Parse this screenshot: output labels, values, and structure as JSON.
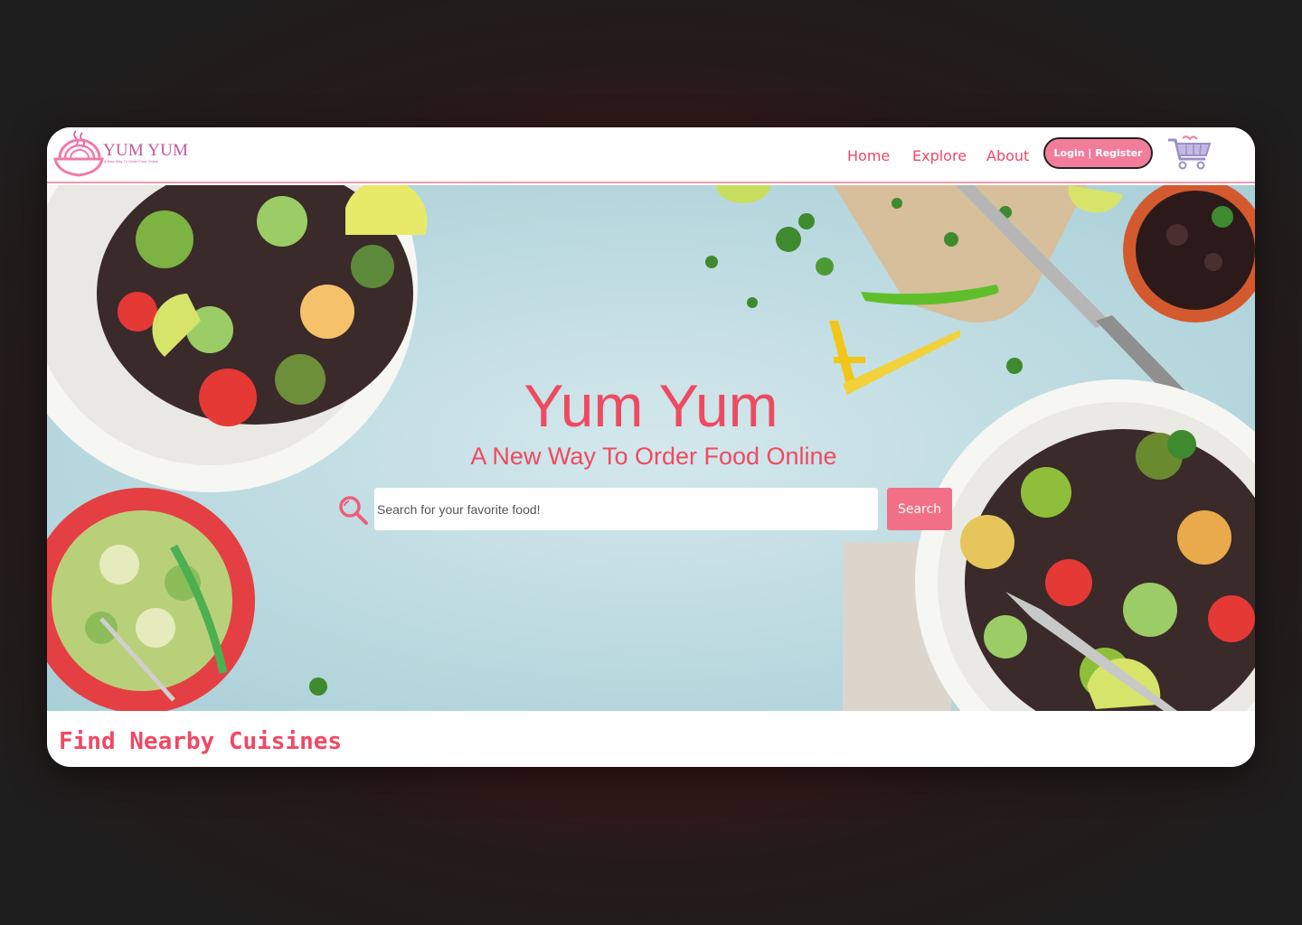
{
  "brand": {
    "name": "YUM YUM",
    "tagline": "A New Way To Order Food Online"
  },
  "nav": {
    "links": [
      "Home",
      "Explore",
      "About"
    ],
    "login_label": "Login | Register"
  },
  "hero": {
    "title": "Yum Yum",
    "subtitle": "A New Way To Order Food Online",
    "search_placeholder": "Search for your favorite food!",
    "search_button": "Search"
  },
  "sections": {
    "nearby_title": "Find Nearby Cuisines"
  },
  "icons": {
    "logo": "steaming-bowl-icon",
    "cart": "shopping-cart-icon",
    "search": "magnifier-icon"
  },
  "colors": {
    "accent": "#f04865",
    "button_pink": "#f27d9b",
    "logo_magenta": "#c2589a",
    "hero_bg": "#c3dfe5",
    "page_bg": "#1e1e1e"
  }
}
